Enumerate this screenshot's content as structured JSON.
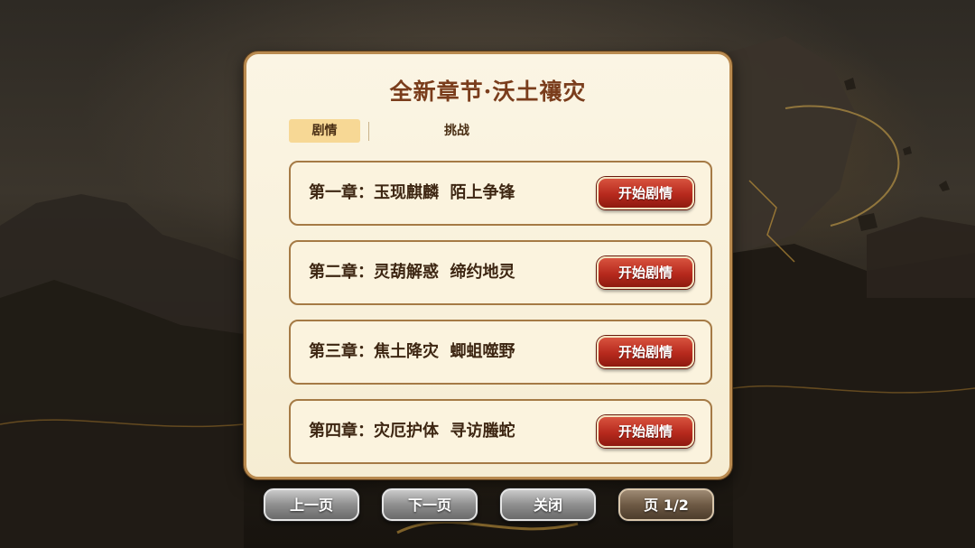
{
  "panel": {
    "title": "全新章节·沃土禳灾"
  },
  "tabs": [
    {
      "label": "剧情",
      "active": true
    },
    {
      "label": "挑战",
      "active": false
    }
  ],
  "chapters": [
    {
      "title": "第一章：玉现麒麟  陌上争锋",
      "button": "开始剧情"
    },
    {
      "title": "第二章：灵葫解惑  缔约地灵",
      "button": "开始剧情"
    },
    {
      "title": "第三章：焦土降灾  蝍蛆噬野",
      "button": "开始剧情"
    },
    {
      "title": "第四章：灾厄护体  寻访螣蛇",
      "button": "开始剧情"
    }
  ],
  "footer": {
    "prev_label": "上一页",
    "next_label": "下一页",
    "close_label": "关闭",
    "page_label": "页 1/2"
  },
  "colors": {
    "title": "#7a3d1c",
    "tab_active": "#f7d895",
    "start_button": "#b6291d",
    "panel_bg": "#fbf5e4"
  }
}
